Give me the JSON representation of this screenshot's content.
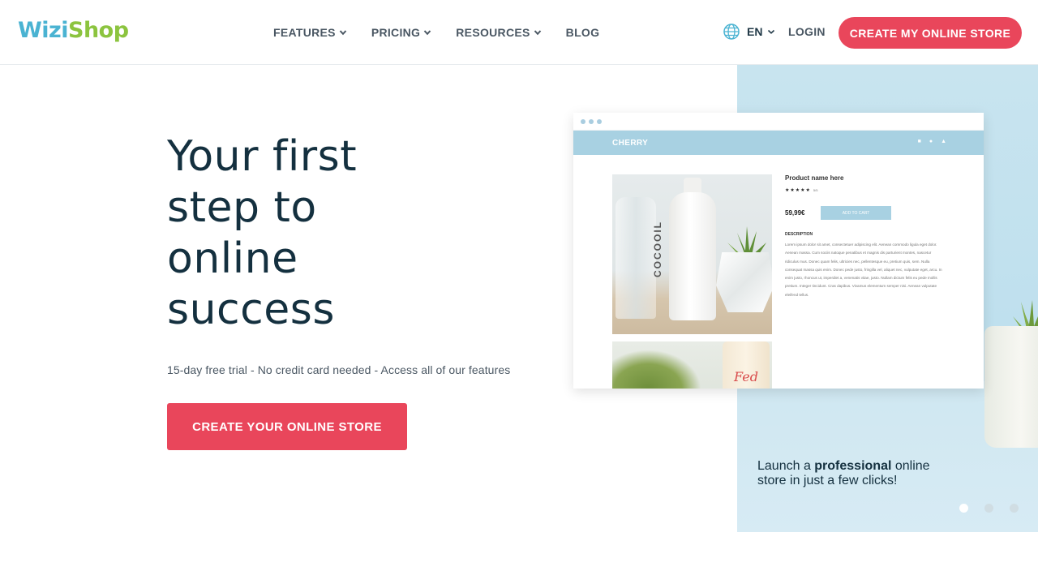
{
  "header": {
    "logo_part1": "Wizi",
    "logo_part2": "Shop",
    "nav": [
      "FEATURES",
      "PRICING",
      "RESOURCES",
      "BLOG"
    ],
    "language": "EN",
    "login": "LOGIN",
    "cta": "CREATE MY ONLINE STORE"
  },
  "hero": {
    "title_lines": [
      "Your first",
      "step to",
      "online",
      "success"
    ],
    "subtitle": "15-day free trial - No credit card needed - Access all of our features",
    "cta": "CREATE YOUR ONLINE STORE"
  },
  "showcase": {
    "caption_pre": "Launch a ",
    "caption_bold": "professional",
    "caption_post": " online store in just a few clicks!",
    "slide_count": 3,
    "active_slide": 1,
    "mock": {
      "brand": "CHERRY",
      "bottle_label": "COCOOIL",
      "jar_label": "Fed",
      "product_name": "Product name here",
      "stars": "★★★★★",
      "rating": "5/5",
      "price": "59,99€",
      "add_to_cart": "ADD TO CART",
      "description_heading": "DESCRIPTION",
      "description": "Lorem ipsum dolor sit amet, consectetuer adipiscing elit. Aenean commodo ligula eget dolor. Aenean massa. Cum sociis natoque penatibus et magnis dis parturient montes, nascetur ridiculus mus. Donec quam felis, ultricies nec, pellentesque eu, pretium quis, sem. Nulla consequat massa quis enim. Donec pede justo, fringilla vel, aliquet nec, vulputate eget, arcu. In enim justo, rhoncus ut, imperdiet a, venenatis vitae, justo. Nullam dictum felis eu pede mollis pretium. Integer tincidunt. Cras dapibus. Vivamus elementum semper nisi. Aenean vulputate eleifend tellus."
    }
  },
  "colors": {
    "accent": "#e9465b",
    "logo_blue": "#4ab3d2",
    "logo_green": "#8cc43f",
    "heading": "#14303f",
    "panel_bg": "#c8e4ef"
  },
  "icons": {
    "language": "globe-icon",
    "dropdown": "chevron-down-icon"
  }
}
